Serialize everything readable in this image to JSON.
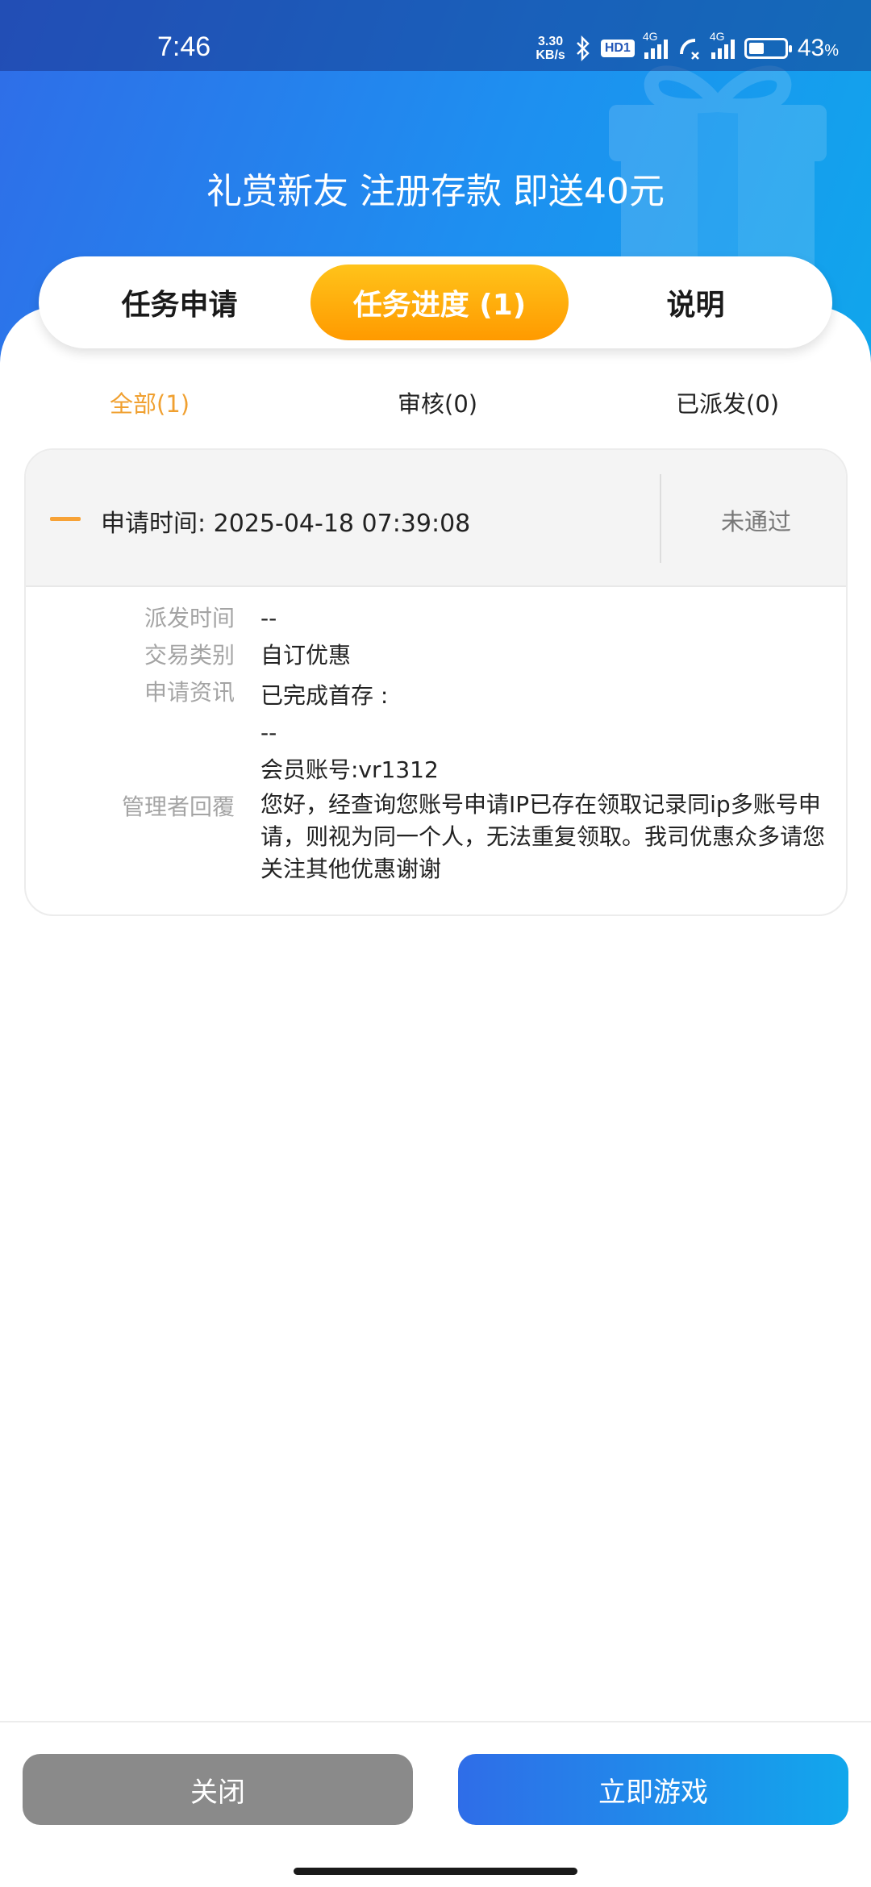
{
  "status_bar": {
    "time": "7:46",
    "net_speed_value": "3.30",
    "net_speed_unit": "KB/s",
    "hd_label": "HD1",
    "signal1_tag": "4G",
    "signal2_tag": "4G",
    "battery_percent": "43",
    "battery_suffix": "%",
    "battery_level": 0.43
  },
  "hero": {
    "title": "礼赏新友 注册存款 即送40元"
  },
  "tabs": [
    {
      "label": "任务申请",
      "active": false
    },
    {
      "label": "任务进度 (1)",
      "active": true
    },
    {
      "label": "说明",
      "active": false
    }
  ],
  "filters": {
    "all": "全部(1)",
    "review": "审核(0)",
    "sent": "已派发(0)"
  },
  "record": {
    "apply_time": "申请时间: 2025-04-18 07:39:08",
    "status": "未通过",
    "fields": {
      "dispatch_time_label": "派发时间",
      "dispatch_time_value": "--",
      "trade_type_label": "交易类别",
      "trade_type_value": "自订优惠",
      "apply_info_label": "申请资讯",
      "apply_info_line1": "已完成首存 :",
      "apply_info_line2": "--",
      "apply_info_line3": "会员账号:vr1312",
      "admin_reply_label": "管理者回覆",
      "admin_reply_value": "您好，经查询您账号申请IP已存在领取记录同ip多账号申请，则视为同一个人，无法重复领取。我司优惠众多请您关注其他优惠谢谢"
    }
  },
  "buttons": {
    "close": "关闭",
    "play": "立即游戏"
  },
  "colors": {
    "accent_orange": "#ff9a00",
    "brand_blue": "#2f6de8",
    "status_muted": "#777777"
  }
}
